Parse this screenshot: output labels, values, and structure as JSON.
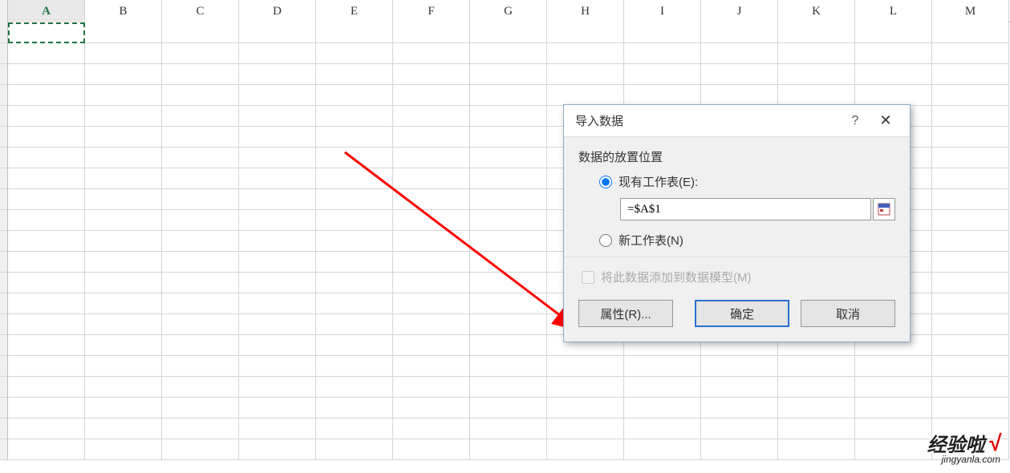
{
  "columns": [
    "A",
    "B",
    "C",
    "D",
    "E",
    "F",
    "G",
    "H",
    "I",
    "J",
    "K",
    "L",
    "M"
  ],
  "selected_column_index": 0,
  "dialog": {
    "title": "导入数据",
    "help_symbol": "?",
    "close_symbol": "✕",
    "section_label": "数据的放置位置",
    "radio_existing": "现有工作表(E):",
    "radio_new": "新工作表(N)",
    "ref_value": "=$A$1",
    "checkbox_model": "将此数据添加到数据模型(M)",
    "btn_properties": "属性(R)...",
    "btn_ok": "确定",
    "btn_cancel": "取消"
  },
  "watermark": {
    "main": "经验啦",
    "check": "√",
    "sub": "jingyanla.com"
  }
}
